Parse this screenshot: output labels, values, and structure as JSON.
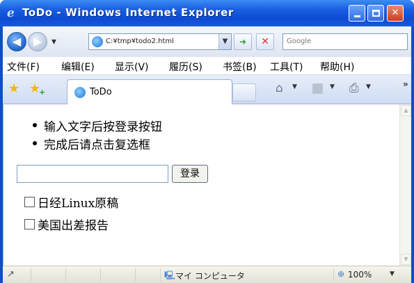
{
  "window": {
    "title": "ToDo - Windows Internet Explorer",
    "icon": "ie-icon",
    "controls": [
      "minimize",
      "maximize",
      "close"
    ]
  },
  "address_bar": {
    "url": "C:¥tmp¥todo2.html",
    "search_placeholder": "Google",
    "back_glyph": "◀",
    "forward_glyph": "▶",
    "go_glyph": "➜",
    "stop_glyph": "✕"
  },
  "menu": {
    "items": [
      "文件(F)",
      "编辑(E)",
      "显示(V)",
      "履历(S)",
      "书签(B)",
      "工具(T)",
      "帮助(H)"
    ]
  },
  "tabs": {
    "active_label": "ToDo",
    "more": "»"
  },
  "content": {
    "bullets": [
      "输入文字后按登录按钮",
      "完成后请点击复选框"
    ],
    "input_value": "",
    "register_button": "登录",
    "todos": [
      {
        "label": "日经Linux原稿",
        "checked": false
      },
      {
        "label": "美国出差报告",
        "checked": false
      }
    ]
  },
  "status": {
    "zone": "マイ コンピュータ",
    "zoom": "100%"
  },
  "colors": {
    "titlebar": "#1a5fe0",
    "close_button": "#c9401d",
    "content_bg": "#ffffff"
  }
}
